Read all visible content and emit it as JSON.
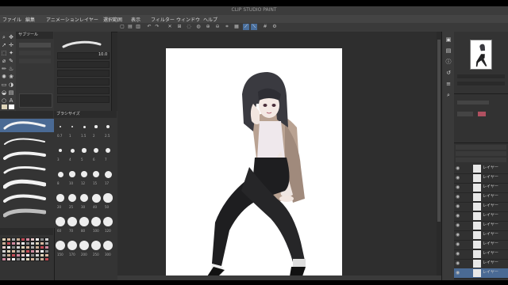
{
  "window": {
    "title": "CLIP STUDIO PAINT"
  },
  "menu": [
    "ファイル",
    "編集",
    "アニメーション",
    "レイヤー",
    "選択範囲",
    "表示",
    "フィルター",
    "ウィンドウ",
    "ヘルプ"
  ],
  "tool_property": {
    "brush_size_value": "10.0"
  },
  "subtool_panel": {
    "tab_label": "サブツール"
  },
  "brush_size_panel": {
    "tab_label": "ブラシサイズ",
    "sizes": [
      "0.7",
      "1",
      "1.5",
      "2",
      "2.5",
      "3",
      "4",
      "5",
      "6",
      "7",
      "8",
      "10",
      "12",
      "15",
      "17",
      "20",
      "25",
      "30",
      "40",
      "50",
      "60",
      "70",
      "80",
      "100",
      "120",
      "150",
      "170",
      "200",
      "250",
      "300"
    ]
  },
  "layer_panel": {
    "layers": [
      "レイヤー",
      "レイヤー",
      "レイヤー",
      "レイヤー",
      "レイヤー",
      "レイヤー",
      "レイヤー",
      "レイヤー",
      "レイヤー",
      "レイヤー",
      "レイヤー",
      "レイヤー"
    ]
  },
  "colors": {
    "accent": "#4a6f9c",
    "panel": "#333333",
    "canvas_bg": "#2e2e2e",
    "swatch_ivory": "#ddd3b9",
    "swatch_skin": "#c8ad95",
    "swatch_pink": "#d08aa0",
    "swatch_red": "#c24a55"
  }
}
